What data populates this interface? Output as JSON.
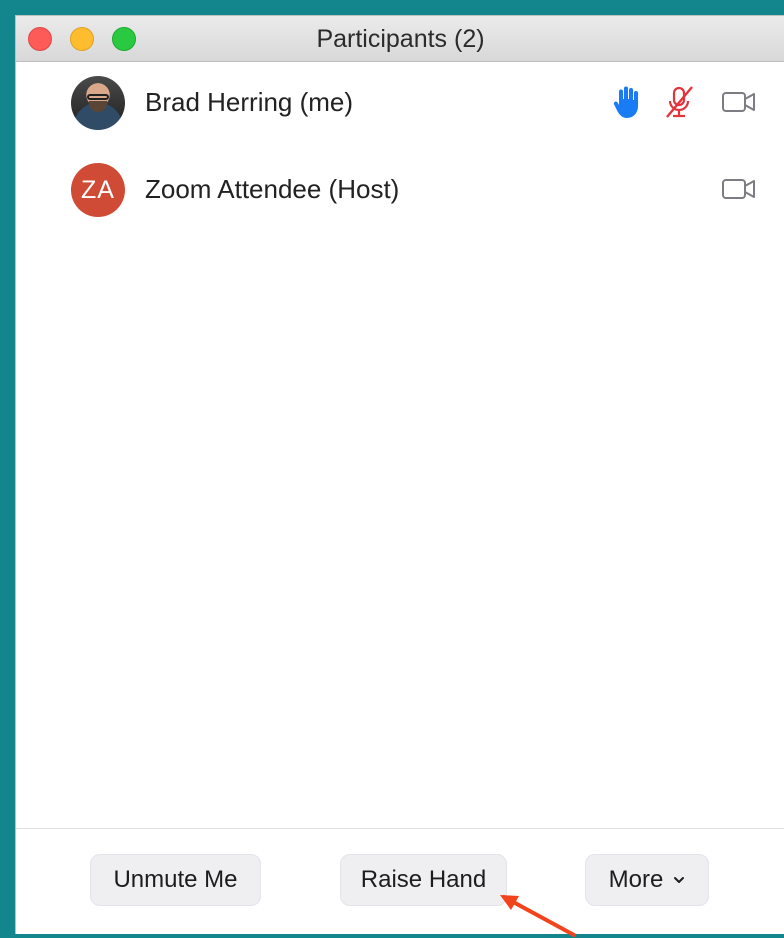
{
  "window": {
    "title": "Participants (2)"
  },
  "participants": [
    {
      "name": "Brad Herring (me)",
      "avatar": {
        "type": "photo"
      },
      "icons": [
        "raised-hand-icon",
        "muted-mic-icon",
        "video-off-icon"
      ]
    },
    {
      "name": "Zoom Attendee (Host)",
      "avatar": {
        "type": "initials",
        "text": "ZA",
        "color": "#d04b35"
      },
      "icons": [
        "video-off-icon"
      ]
    }
  ],
  "footer": {
    "unmute_label": "Unmute Me",
    "raise_hand_label": "Raise Hand",
    "more_label": "More"
  },
  "colors": {
    "frame": "#12868c",
    "hand": "#1a7cf5",
    "muted_mic": "#e5333c",
    "video_icon": "#7c7c82",
    "annotation_arrow": "#f1441d"
  }
}
